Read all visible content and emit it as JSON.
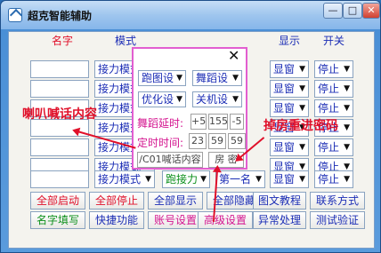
{
  "window": {
    "title": "超克智能辅助",
    "min_glyph": "—",
    "max_glyph": "□",
    "close_glyph": "✕"
  },
  "headers": {
    "name": "名字",
    "mode": "模式",
    "display": "显示",
    "switch": "开关"
  },
  "rows": [
    {
      "mode": "接力模式",
      "display": "显窗",
      "switch": "停止"
    },
    {
      "mode": "接力模式",
      "display": "显窗",
      "switch": "停止"
    },
    {
      "mode": "接力模式",
      "display": "显窗",
      "switch": "停止"
    },
    {
      "mode": "接力模式",
      "display": "显窗",
      "switch": "停止"
    },
    {
      "mode": "接力模式",
      "display": "显窗",
      "switch": "停止"
    },
    {
      "mode": "接力模式",
      "display": "显窗",
      "switch": "停止"
    },
    {
      "mode": "接力模式",
      "extra1": "跑接力",
      "extra2": "第一名",
      "display": "显窗",
      "switch": "停止"
    }
  ],
  "panel": {
    "close": "✕",
    "dd1": "跑图设",
    "dd2": "舞蹈设",
    "dd3": "优化设",
    "dd4": "关机设",
    "dance_label": "舞蹈延时:",
    "dance_vals": [
      "+5",
      "155",
      "-5"
    ],
    "timer_label": "定时时间:",
    "timer_vals": [
      "23",
      "59",
      "59"
    ],
    "shout": "/C01喊话内容",
    "room": "房 密"
  },
  "buttons_row1": [
    "全部启动",
    "全部停止",
    "全部显示",
    "全部隐藏",
    "图文教程",
    "联系方式"
  ],
  "buttons_row2": [
    "名字填写",
    "快捷功能",
    "账号设置",
    "高级设置",
    "异常处理",
    "测试验证"
  ],
  "annotations": {
    "left": "喇叭喊话内容",
    "right": "掉房重进密码"
  },
  "colors": {
    "red": "#e0102a",
    "blue": "#1b2db5",
    "green": "#0b8f1a",
    "pink": "#d4148f",
    "panel_border": "#e25ed0"
  }
}
